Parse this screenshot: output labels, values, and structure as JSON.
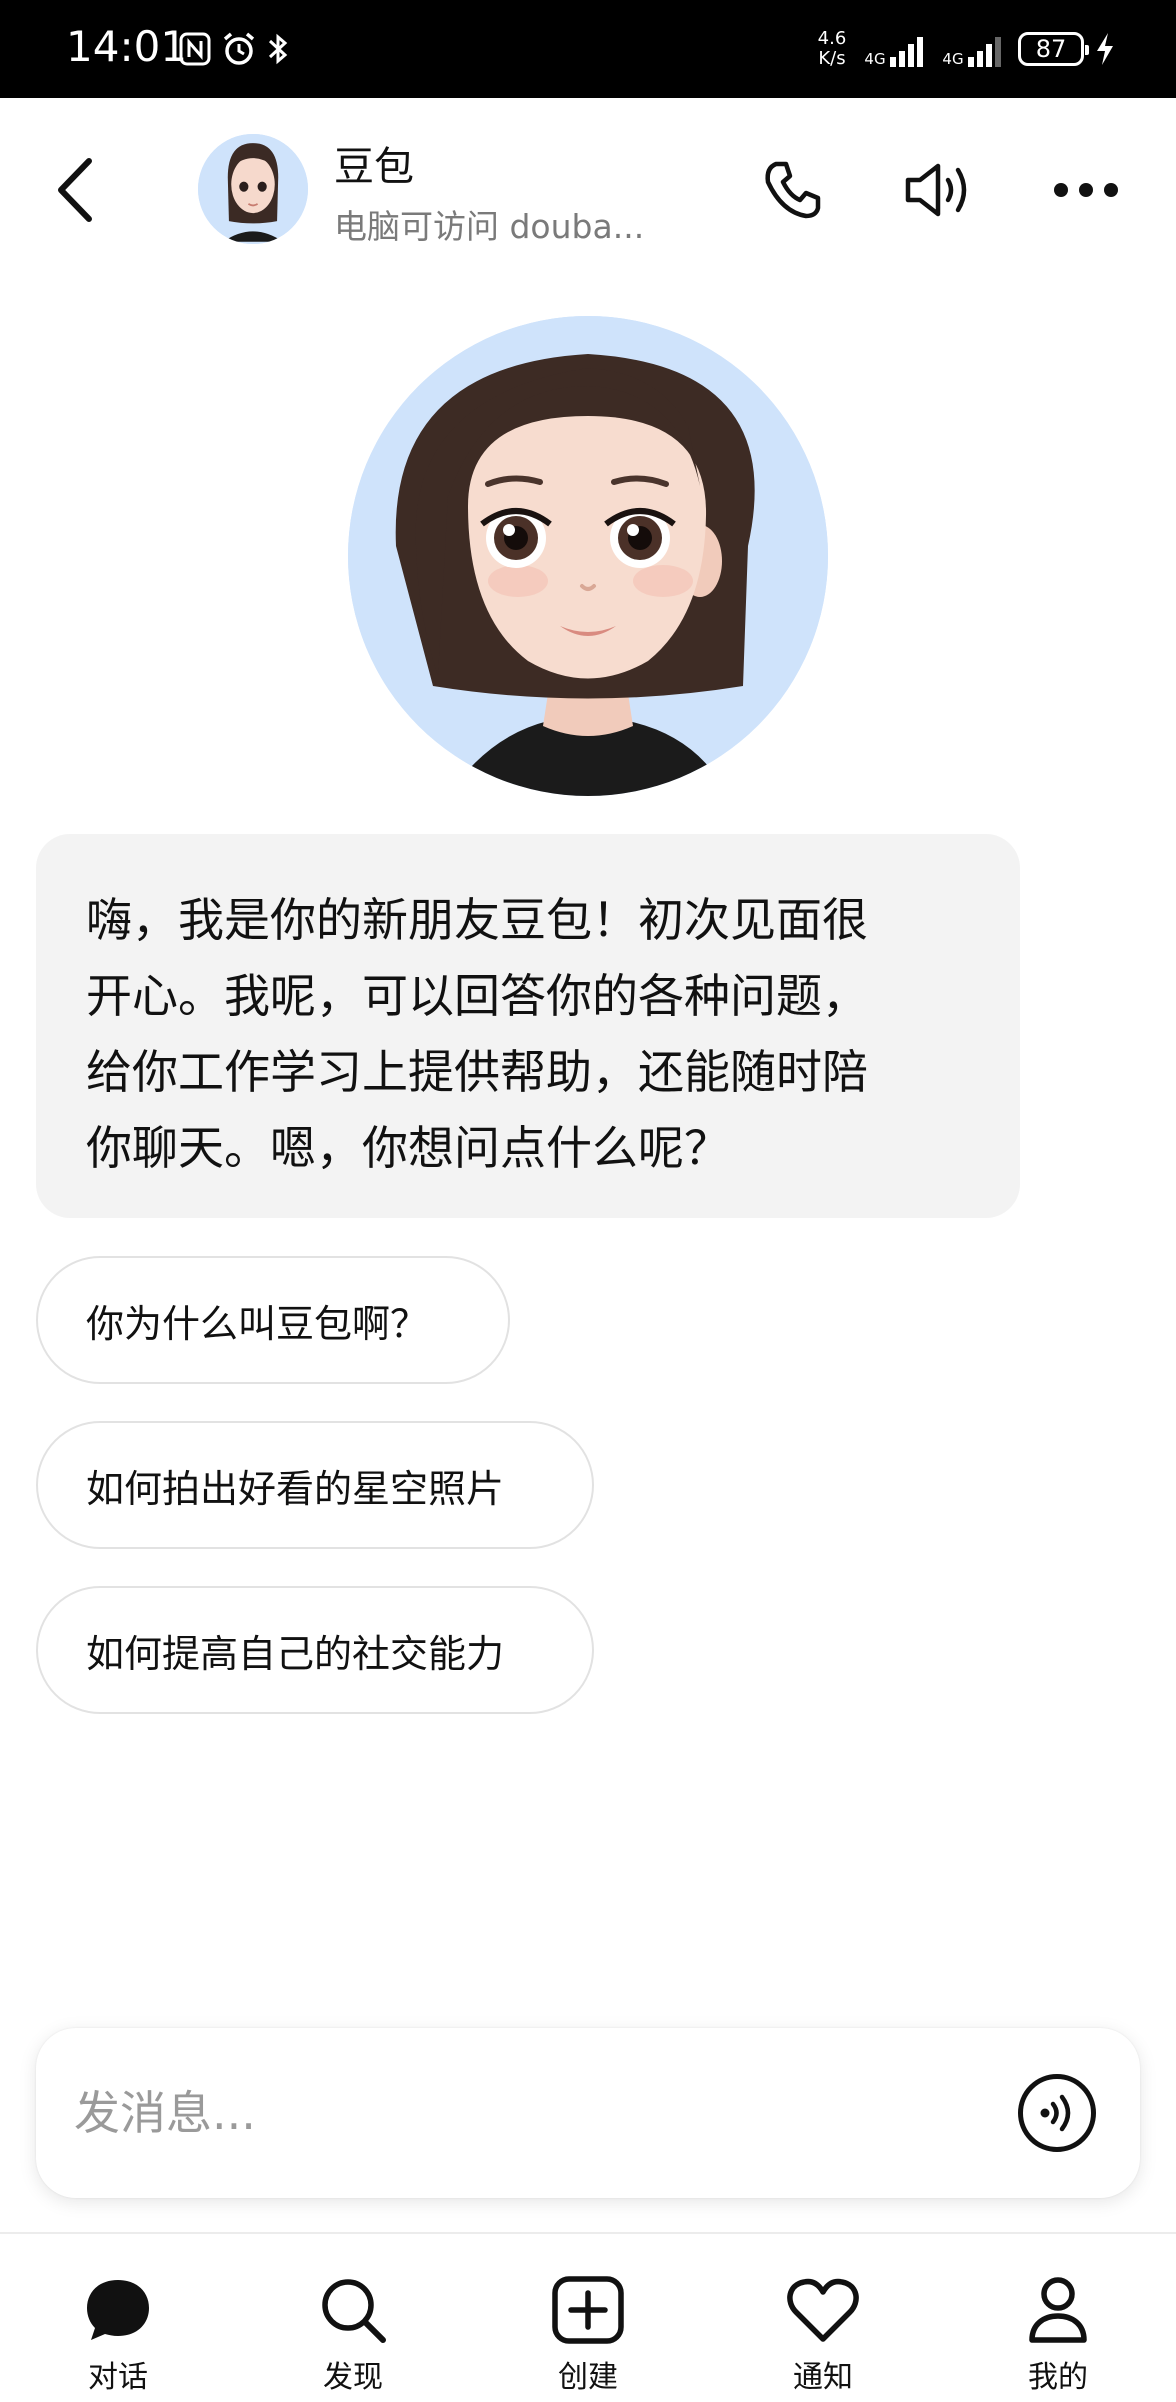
{
  "status_bar": {
    "time": "14:01",
    "net_speed_top": "4.6",
    "net_speed_bottom": "K/s",
    "signal1_tag": "4G",
    "signal2_tag": "4G",
    "battery": "87"
  },
  "header": {
    "name": "豆包",
    "subtitle": "电脑可访问 douba..."
  },
  "message": {
    "lines": [
      "嗨，我是你的新朋友豆包！初次见面很",
      "开心。我呢，可以回答你的各种问题，",
      "给你工作学习上提供帮助，还能随时陪",
      "你聊天。嗯，你想问点什么呢？"
    ]
  },
  "suggestions": [
    "你为什么叫豆包啊？",
    "如何拍出好看的星空照片",
    "如何提高自己的社交能力"
  ],
  "input": {
    "placeholder": "发消息..."
  },
  "nav": {
    "items": [
      "对话",
      "发现",
      "创建",
      "通知",
      "我的"
    ]
  }
}
